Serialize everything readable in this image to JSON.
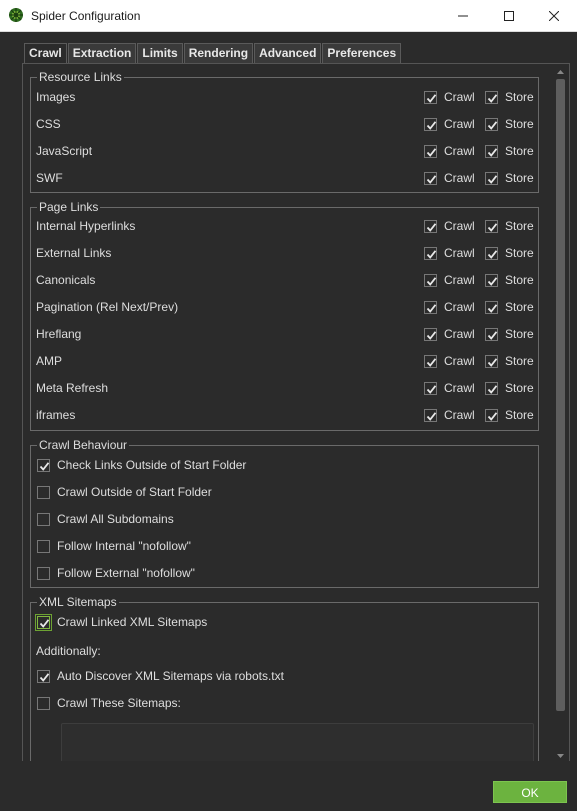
{
  "window": {
    "title": "Spider Configuration",
    "accent_color": "#6cb33f"
  },
  "tabs": [
    {
      "label": "Crawl"
    },
    {
      "label": "Extraction"
    },
    {
      "label": "Limits"
    },
    {
      "label": "Rendering"
    },
    {
      "label": "Advanced"
    },
    {
      "label": "Preferences"
    }
  ],
  "active_tab": "Crawl",
  "resource_links": {
    "title": "Resource Links",
    "crawl_label": "Crawl",
    "store_label": "Store",
    "items": [
      {
        "label": "Images",
        "crawl": true,
        "store": true
      },
      {
        "label": "CSS",
        "crawl": true,
        "store": true
      },
      {
        "label": "JavaScript",
        "crawl": true,
        "store": true
      },
      {
        "label": "SWF",
        "crawl": true,
        "store": true
      }
    ]
  },
  "page_links": {
    "title": "Page Links",
    "crawl_label": "Crawl",
    "store_label": "Store",
    "items": [
      {
        "label": "Internal Hyperlinks",
        "crawl": true,
        "store": true
      },
      {
        "label": "External Links",
        "crawl": true,
        "store": true
      },
      {
        "label": "Canonicals",
        "crawl": true,
        "store": true
      },
      {
        "label": "Pagination (Rel Next/Prev)",
        "crawl": true,
        "store": true
      },
      {
        "label": "Hreflang",
        "crawl": true,
        "store": true
      },
      {
        "label": "AMP",
        "crawl": true,
        "store": true
      },
      {
        "label": "Meta Refresh",
        "crawl": true,
        "store": true
      },
      {
        "label": "iframes",
        "crawl": true,
        "store": true
      }
    ]
  },
  "crawl_behaviour": {
    "title": "Crawl Behaviour",
    "items": [
      {
        "label": "Check Links Outside of Start Folder",
        "checked": true
      },
      {
        "label": "Crawl Outside of Start Folder",
        "checked": false
      },
      {
        "label": "Crawl All Subdomains",
        "checked": false
      },
      {
        "label": "Follow Internal \"nofollow\"",
        "checked": false
      },
      {
        "label": "Follow External \"nofollow\"",
        "checked": false
      }
    ]
  },
  "xml_sitemaps": {
    "title": "XML Sitemaps",
    "crawl_linked": {
      "label": "Crawl Linked XML Sitemaps",
      "checked": true
    },
    "additionally_label": "Additionally:",
    "auto_discover": {
      "label": "Auto Discover XML Sitemaps via robots.txt",
      "checked": true
    },
    "crawl_these": {
      "label": "Crawl These Sitemaps:",
      "checked": false
    },
    "sitemaps_text": ""
  },
  "footer": {
    "ok_label": "OK"
  }
}
